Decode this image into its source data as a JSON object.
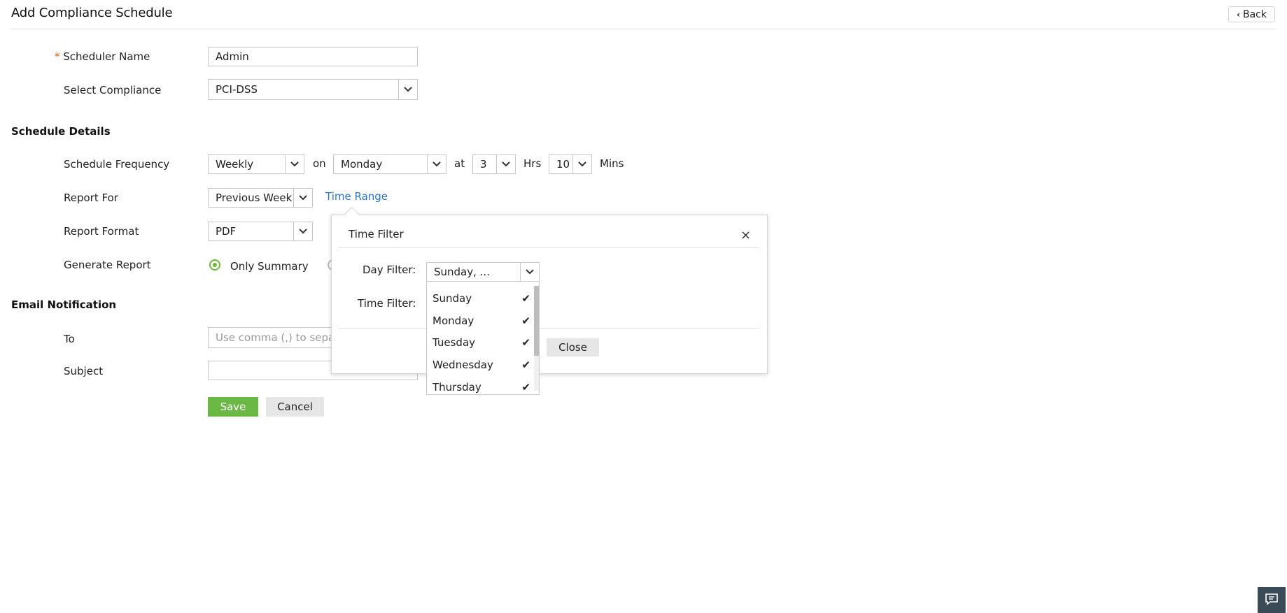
{
  "header": {
    "title": "Add Compliance Schedule",
    "back_label": "Back"
  },
  "form": {
    "scheduler_name": {
      "required_mark": "*",
      "label": "Scheduler Name",
      "value": "Admin"
    },
    "select_compliance": {
      "label": "Select Compliance",
      "value": "PCI-DSS"
    }
  },
  "schedule_details": {
    "heading": "Schedule Details",
    "frequency": {
      "label": "Schedule Frequency",
      "value": "Weekly",
      "on_text": "on",
      "day_value": "Monday",
      "at_text": "at",
      "hour_value": "3",
      "hrs_text": "Hrs",
      "min_value": "10",
      "mins_text": "Mins"
    },
    "report_for": {
      "label": "Report For",
      "value": "Previous Week",
      "time_range_link": "Time Range"
    },
    "report_format": {
      "label": "Report Format",
      "value": "PDF"
    },
    "generate_report": {
      "label": "Generate Report",
      "option_selected": "Only Summary"
    }
  },
  "email_notification": {
    "heading": "Email Notification",
    "to": {
      "label": "To",
      "placeholder": "Use comma (,) to separ"
    },
    "subject": {
      "label": "Subject",
      "value": ""
    }
  },
  "actions": {
    "save": "Save",
    "cancel": "Cancel"
  },
  "time_filter_popup": {
    "title": "Time Filter",
    "close_glyph": "×",
    "day_filter_label": "Day Filter:",
    "day_filter_value": "Sunday, ...",
    "time_filter_label": "Time Filter:",
    "close_button": "Close",
    "day_options": [
      {
        "label": "Sunday",
        "checked": true
      },
      {
        "label": "Monday",
        "checked": true
      },
      {
        "label": "Tuesday",
        "checked": true
      },
      {
        "label": "Wednesday",
        "checked": true
      },
      {
        "label": "Thursday",
        "checked": true
      }
    ]
  },
  "colors": {
    "accent_green": "#6cb844",
    "link_blue": "#2a76c6",
    "required_orange": "#e25c10",
    "feedback_bg": "#3a4a57"
  },
  "icons": {
    "back": "chevron-left-icon",
    "dropdown": "chevron-down-icon",
    "check": "check-icon",
    "feedback": "chat-icon"
  }
}
